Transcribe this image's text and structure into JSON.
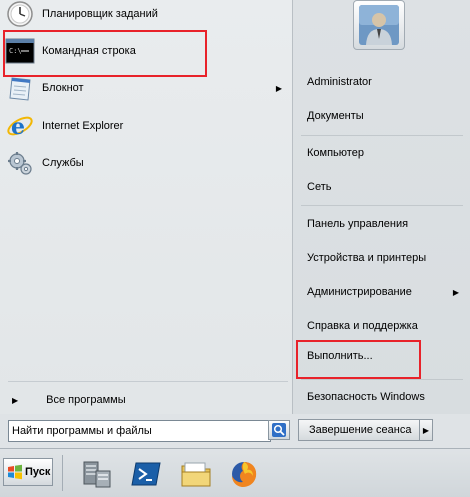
{
  "start_menu": {
    "programs": [
      {
        "label": "Планировщик заданий",
        "icon": "task-scheduler-icon"
      },
      {
        "label": "Командная строка",
        "icon": "command-prompt-icon"
      },
      {
        "label": "Блокнот",
        "icon": "notepad-icon",
        "has_submenu": true
      },
      {
        "label": "Internet Explorer",
        "icon": "internet-explorer-icon"
      },
      {
        "label": "Службы",
        "icon": "services-icon"
      }
    ],
    "all_programs": "Все программы",
    "right": {
      "user": "Administrator",
      "items": [
        {
          "label": "Документы"
        },
        {
          "label": "Компьютер"
        },
        {
          "label": "Сеть"
        },
        {
          "label": "Панель управления"
        },
        {
          "label": "Устройства и принтеры"
        },
        {
          "label": "Администрирование"
        },
        {
          "label": "Справка и поддержка"
        },
        {
          "label": "Выполнить..."
        },
        {
          "label": "Безопасность Windows"
        }
      ]
    },
    "search_placeholder": "Найти программы и файлы",
    "shutdown_label": "Завершение сеанса"
  },
  "taskbar": {
    "start_label": "Пуск",
    "pinned": [
      "server-manager-icon",
      "powershell-icon",
      "explorer-folder-icon",
      "firefox-icon"
    ]
  },
  "colors": {
    "highlight": "#e8222a"
  }
}
